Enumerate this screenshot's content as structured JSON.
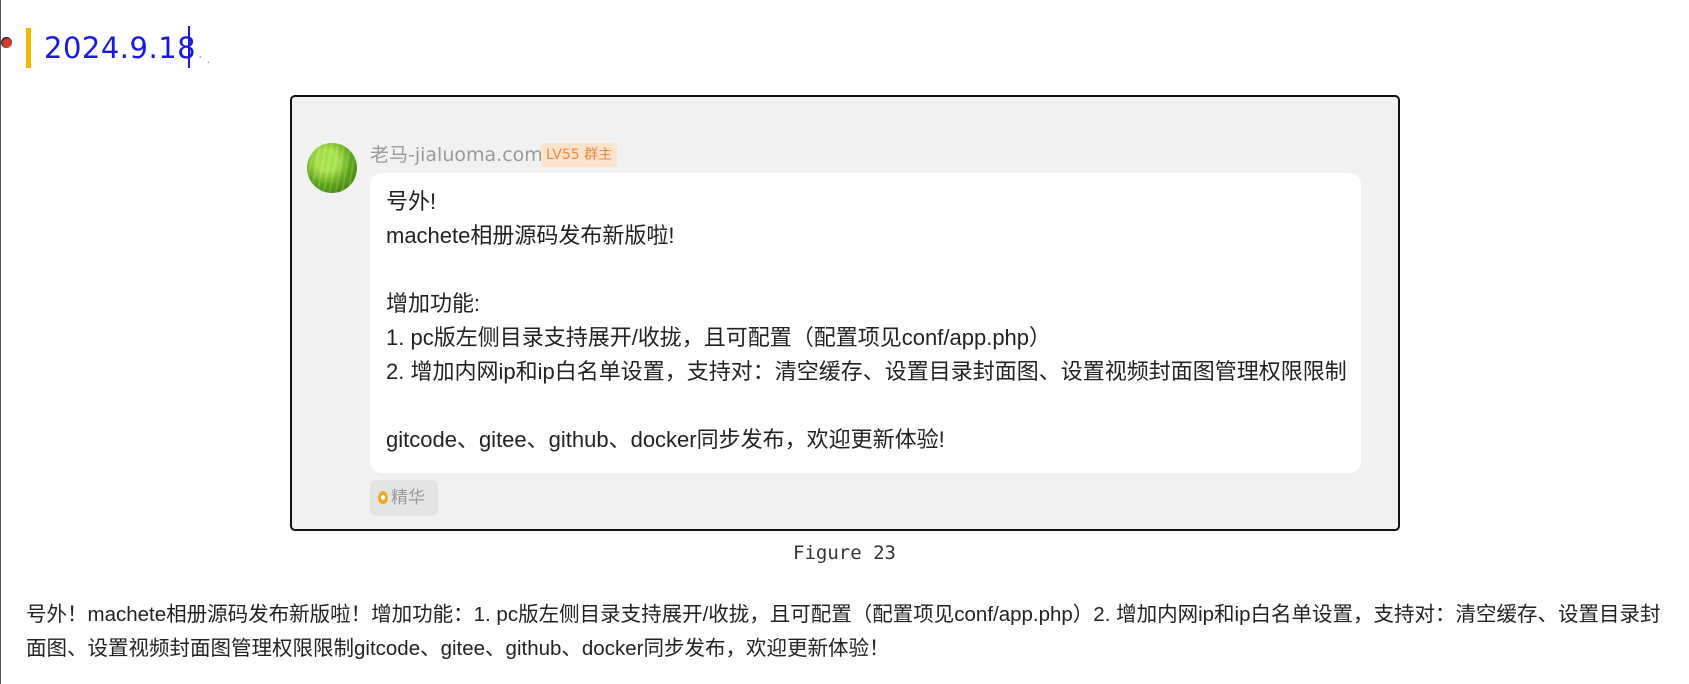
{
  "heading": {
    "date": "2024.9.18"
  },
  "post": {
    "username": "老马-jialuoma.com",
    "badge": "LV55 群主",
    "message_lines": [
      "号外!",
      "machete相册源码发布新版啦!",
      "",
      "增加功能:",
      "1. pc版左侧目录支持展开/收拢，且可配置（配置项见conf/app.php）",
      "2. 增加内网ip和ip白名单设置，支持对：清空缓存、设置目录封面图、设置视频封面图管理权限限制",
      "",
      "gitcode、gitee、github、docker同步发布，欢迎更新体验!"
    ],
    "tag_label": "精华",
    "tag_icon": "flame-icon"
  },
  "caption": "Figure 23",
  "paragraph": "号外！machete相册源码发布新版啦！增加功能：1. pc版左侧目录支持展开/收拢，且可配置（配置项见conf/app.php）2. 增加内网ip和ip白名单设置，支持对：清空缓存、设置目录封面图、设置视频封面图管理权限限制gitcode、gitee、github、docker同步发布，欢迎更新体验！"
}
